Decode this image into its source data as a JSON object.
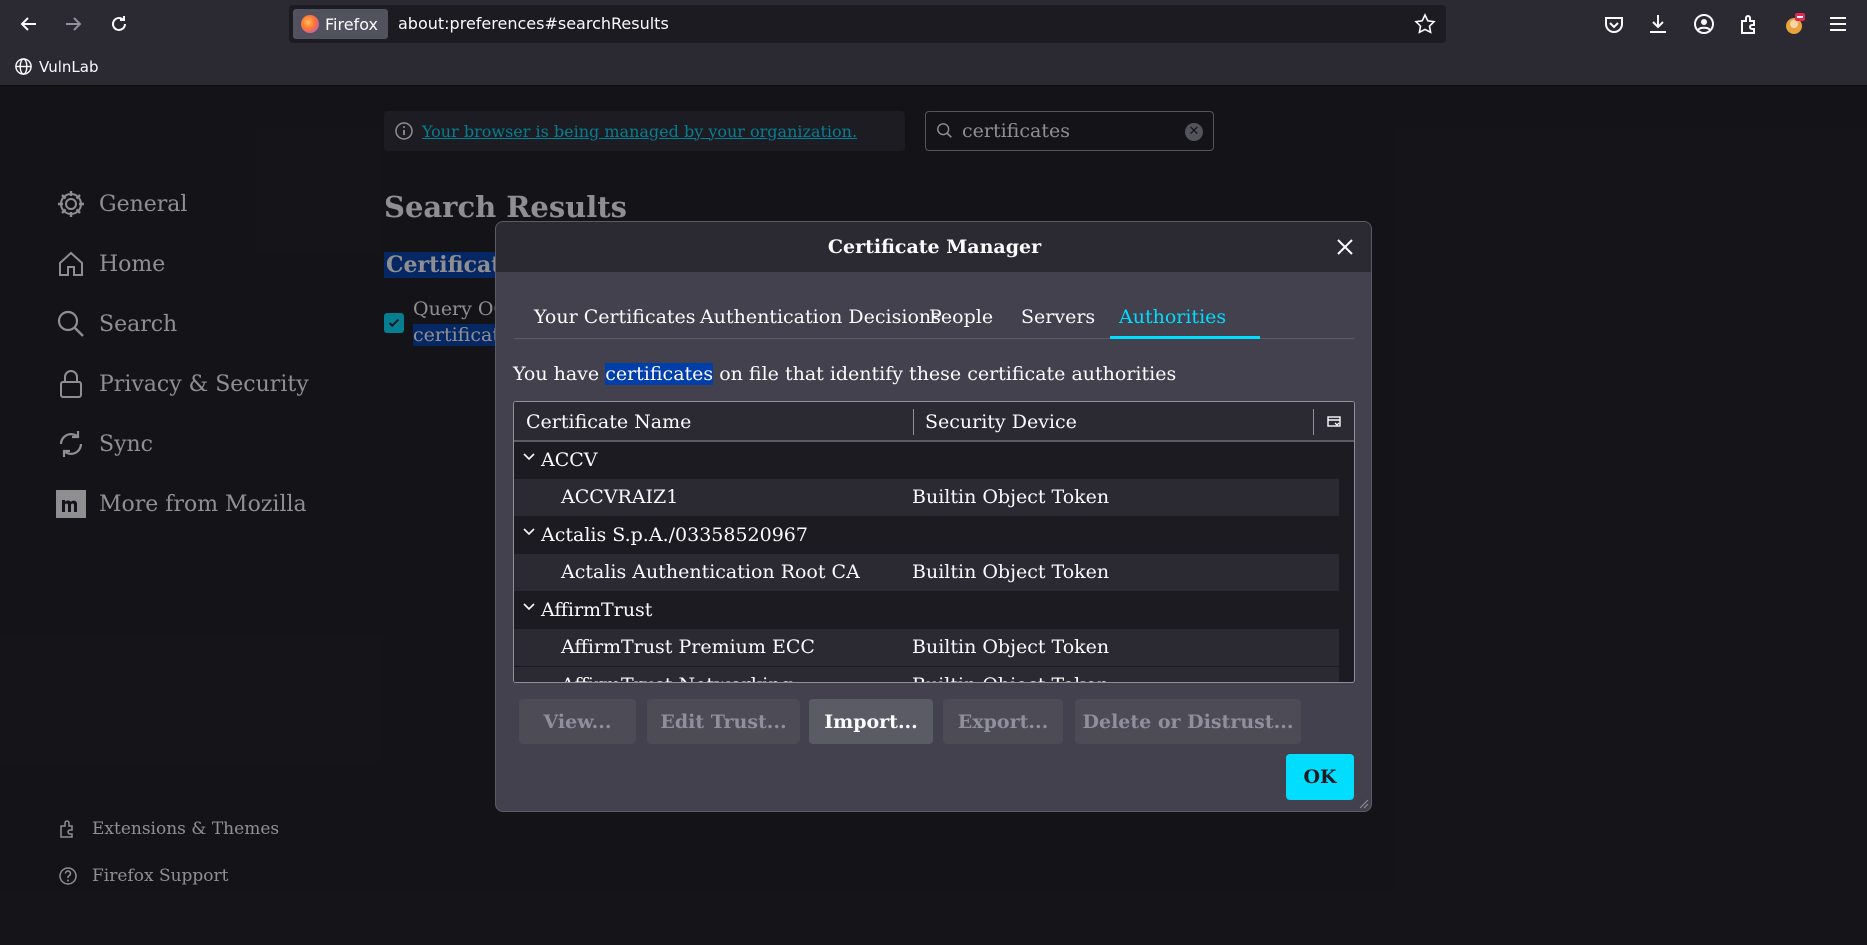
{
  "browser": {
    "identity_label": "Firefox",
    "url": "about:preferences#searchResults",
    "bookmark": "VulnLab"
  },
  "managed_notice": "Your browser is being managed by your organization.",
  "search": {
    "value": "certificates"
  },
  "sidebar": {
    "items": [
      {
        "label": "General",
        "icon": "gear-icon"
      },
      {
        "label": "Home",
        "icon": "home-icon"
      },
      {
        "label": "Search",
        "icon": "search-icon"
      },
      {
        "label": "Privacy & Security",
        "icon": "lock-icon"
      },
      {
        "label": "Sync",
        "icon": "sync-icon"
      },
      {
        "label": "More from Mozilla",
        "icon": "mozilla-icon"
      }
    ],
    "footer": [
      {
        "label": "Extensions & Themes",
        "icon": "puzzle-icon"
      },
      {
        "label": "Firefox Support",
        "icon": "help-icon"
      }
    ]
  },
  "main": {
    "title": "Search Results",
    "section_heading": "Certificate",
    "ocsp_line1": "Query OC",
    "ocsp_line2": "certificate"
  },
  "dialog": {
    "title": "Certificate Manager",
    "tabs": [
      "Your Certificates",
      "Authentication Decisions",
      "People",
      "Servers",
      "Authorities"
    ],
    "active_tab": "Authorities",
    "intro_before": "You have ",
    "intro_highlight": "certificates",
    "intro_after": " on file that identify these certificate authorities",
    "columns": [
      "Certificate Name",
      "Security Device"
    ],
    "rows": [
      {
        "type": "group",
        "name": "ACCV"
      },
      {
        "type": "cert",
        "name": "ACCVRAIZ1",
        "device": "Builtin Object Token"
      },
      {
        "type": "group",
        "name": "Actalis S.p.A./03358520967"
      },
      {
        "type": "cert",
        "name": "Actalis Authentication Root CA",
        "device": "Builtin Object Token"
      },
      {
        "type": "group",
        "name": "AffirmTrust"
      },
      {
        "type": "cert",
        "name": "AffirmTrust Premium ECC",
        "device": "Builtin Object Token"
      },
      {
        "type": "cert",
        "name": "AffirmTrust Networking",
        "device": "Builtin Object Token"
      }
    ],
    "buttons": {
      "view": "View...",
      "edit_trust": "Edit Trust...",
      "import": "Import...",
      "export": "Export...",
      "delete": "Delete or Distrust..."
    },
    "ok": "OK"
  },
  "colors": {
    "accent": "#00ddff",
    "highlight": "#003eaa",
    "dialog_bg": "#42414d",
    "page_bg": "#1c1b22"
  }
}
